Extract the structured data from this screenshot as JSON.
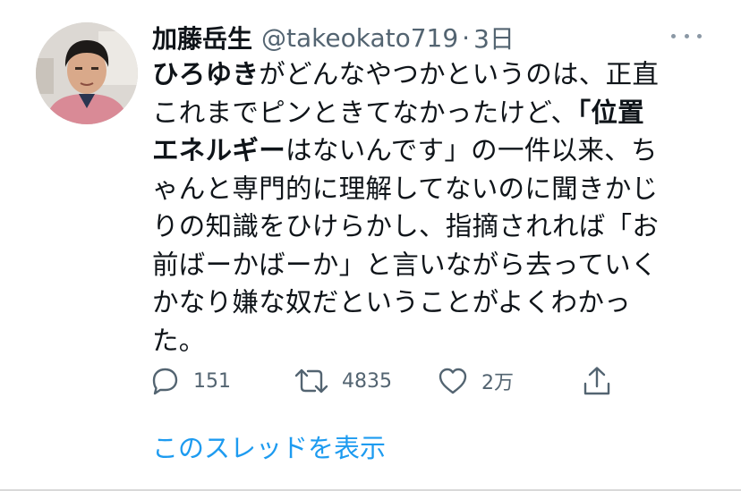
{
  "author": {
    "name": "加藤岳生",
    "handle": "@takeokato719",
    "separator": "·",
    "time": "3日"
  },
  "tweet": {
    "lines": [
      [
        {
          "t": "ひろゆき",
          "b": true
        },
        {
          "t": "がどんなやつかというのは、正直"
        }
      ],
      [
        {
          "t": "これまでピンときてなかったけど、"
        },
        {
          "t": "「位置",
          "b": true
        }
      ],
      [
        {
          "t": "エネルギー",
          "b": true
        },
        {
          "t": "はないんです」の一件以来、ち"
        }
      ],
      [
        {
          "t": "ゃんと専門的に理解してないのに聞きかじ"
        }
      ],
      [
        {
          "t": "りの知識をひけらかし、指摘されれば「お"
        }
      ],
      [
        {
          "t": "前ばーかばーか」と言いながら去っていく"
        }
      ],
      [
        {
          "t": "かなり嫌な奴だということがよくわかっ"
        }
      ],
      [
        {
          "t": "た。"
        }
      ]
    ]
  },
  "actions": {
    "reply_count": "151",
    "retweet_count": "4835",
    "like_count": "2万"
  },
  "thread_link": "このスレッドを表示",
  "icons": [
    "reply-icon",
    "retweet-icon",
    "like-icon",
    "share-icon",
    "more-icon"
  ],
  "colors": {
    "link": "#1d9bf0",
    "muted": "#536471",
    "text": "#0f1419"
  }
}
